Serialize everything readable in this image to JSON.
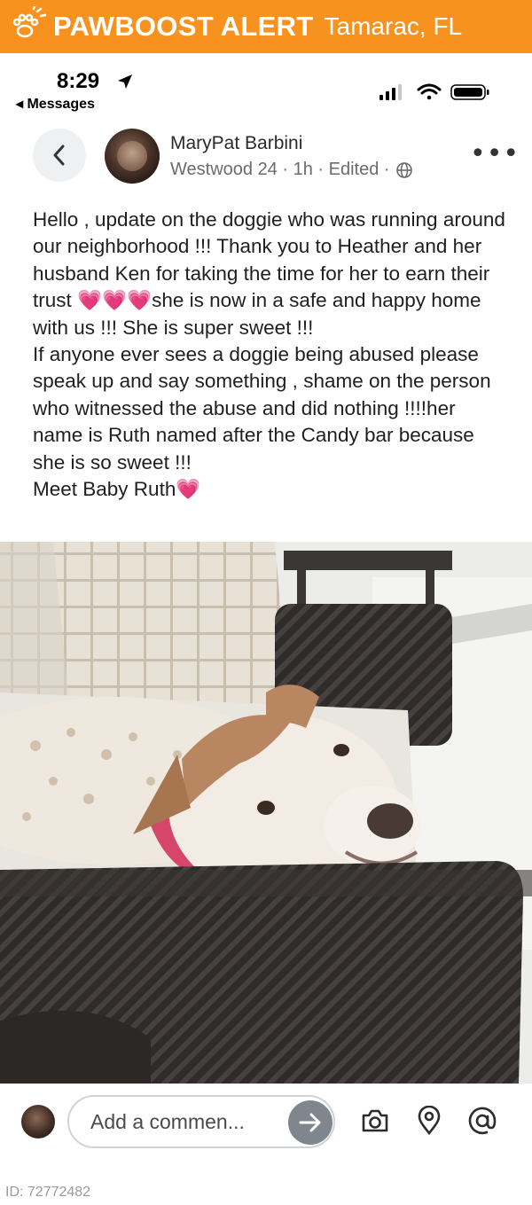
{
  "banner": {
    "brand": "PAWBOOST ALERT",
    "location": "Tamarac, FL",
    "color": "#f7921e"
  },
  "status_bar": {
    "time": "8:29",
    "back_app": "◂ Messages",
    "icons": [
      "signal-icon",
      "wifi-icon",
      "battery-icon",
      "location-arrow-icon"
    ]
  },
  "post": {
    "author": "MaryPat Barbini",
    "group": "Westwood 24",
    "time": "1h",
    "edited": "Edited",
    "more": "•••",
    "text_parts": {
      "p1": "Hello , update on the doggie who was running around our neighborhood !!! Thank you to Heather and her husband Ken for taking the time for her to earn their trust ",
      "hearts1": "💗💗💗",
      "p2": "she is now in a safe and happy home with us !!! She is super sweet !!!\nIf anyone ever sees a doggie being abused please speak up and say something , shame on the person who witnessed the abuse and did nothing !!!!her name is Ruth named after the Candy bar because she is so sweet !!!\nMeet Baby Ruth",
      "hearts2": "💗"
    },
    "accent_heart_color": "#e22a9a"
  },
  "comment_bar": {
    "placeholder": "Add a commen...",
    "icons": [
      "send-arrow-icon",
      "camera-icon",
      "location-pin-icon",
      "at-sign-icon"
    ]
  },
  "footer": {
    "image_id": "ID: 72772482"
  }
}
